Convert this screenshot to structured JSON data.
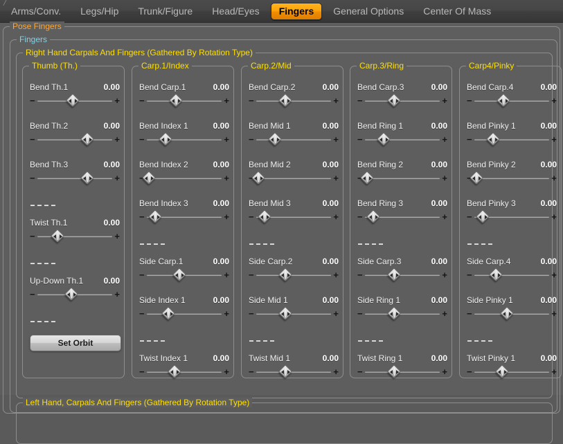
{
  "colors": {
    "accent_active_tab": "#f5a000",
    "panel_bg": "#5e5e5e",
    "legend_orange": "#ffa732",
    "legend_cyan": "#7fd4e8",
    "legend_yellow": "#ffe000",
    "label_text": "#efefef"
  },
  "tabs": [
    {
      "label": "Arms/Conv.",
      "active": false
    },
    {
      "label": "Legs/Hip",
      "active": false
    },
    {
      "label": "Trunk/Figure",
      "active": false
    },
    {
      "label": "Head/Eyes",
      "active": false
    },
    {
      "label": "Fingers",
      "active": true
    },
    {
      "label": "General Options",
      "active": false
    },
    {
      "label": "Center Of Mass",
      "active": false
    }
  ],
  "groups": {
    "pose_fingers": "Pose Fingers",
    "fingers": "Fingers",
    "right_hand": "Right Hand Carpals And Fingers (Gathered By Rotation Type)",
    "left_hand": "Left Hand, Carpals And Fingers (Gathered By Rotation Type)"
  },
  "slider_marks": {
    "minus": "−",
    "plus": "+"
  },
  "separator_text": "-------",
  "columns": [
    {
      "title": "Thumb (Th.)",
      "items": [
        {
          "kind": "slider",
          "label": "Bend Th.1",
          "value": "0.00",
          "pos": 48
        },
        {
          "kind": "slider",
          "label": "Bend Th.2",
          "value": "0.00",
          "pos": 68
        },
        {
          "kind": "slider",
          "label": "Bend Th.3",
          "value": "0.00",
          "pos": 68
        },
        {
          "kind": "sep"
        },
        {
          "kind": "slider",
          "label": "Twist Th.1",
          "value": "0.00",
          "pos": 28
        },
        {
          "kind": "sep"
        },
        {
          "kind": "slider",
          "label": "Up-Down Th.1",
          "value": "0.00",
          "pos": 46
        },
        {
          "kind": "sep"
        },
        {
          "kind": "button",
          "label": "Set Orbit"
        }
      ]
    },
    {
      "title": "Carp.1/Index",
      "items": [
        {
          "kind": "slider",
          "label": "Bend Carp.1",
          "value": "0.00",
          "pos": 40
        },
        {
          "kind": "slider",
          "label": "Bend Index 1",
          "value": "0.00",
          "pos": 26
        },
        {
          "kind": "slider",
          "label": "Bend Index 2",
          "value": "0.00",
          "pos": 4
        },
        {
          "kind": "slider",
          "label": "Bend Index 3",
          "value": "0.00",
          "pos": 12
        },
        {
          "kind": "sep"
        },
        {
          "kind": "slider",
          "label": "Side Carp.1",
          "value": "0.00",
          "pos": 44
        },
        {
          "kind": "slider",
          "label": "Side Index 1",
          "value": "0.00",
          "pos": 30
        },
        {
          "kind": "sep"
        },
        {
          "kind": "slider",
          "label": "Twist Index 1",
          "value": "0.00",
          "pos": 38
        }
      ]
    },
    {
      "title": "Carp.2/Mid",
      "items": [
        {
          "kind": "slider",
          "label": "Bend Carp.2",
          "value": "0.00",
          "pos": 40
        },
        {
          "kind": "slider",
          "label": "Bend Mid 1",
          "value": "0.00",
          "pos": 26
        },
        {
          "kind": "slider",
          "label": "Bend Mid 2",
          "value": "0.00",
          "pos": 4
        },
        {
          "kind": "slider",
          "label": "Bend Mid 3",
          "value": "0.00",
          "pos": 12
        },
        {
          "kind": "sep"
        },
        {
          "kind": "slider",
          "label": "Side Carp.2",
          "value": "0.00",
          "pos": 40
        },
        {
          "kind": "slider",
          "label": "Side Mid 1",
          "value": "0.00",
          "pos": 40
        },
        {
          "kind": "sep"
        },
        {
          "kind": "slider",
          "label": "Twist Mid 1",
          "value": "0.00",
          "pos": 40
        }
      ]
    },
    {
      "title": "Carp.3/Ring",
      "items": [
        {
          "kind": "slider",
          "label": "Bend Carp.3",
          "value": "0.00",
          "pos": 40
        },
        {
          "kind": "slider",
          "label": "Bend Ring 1",
          "value": "0.00",
          "pos": 26
        },
        {
          "kind": "slider",
          "label": "Bend Ring 2",
          "value": "0.00",
          "pos": 4
        },
        {
          "kind": "slider",
          "label": "Bend Ring 3",
          "value": "0.00",
          "pos": 12
        },
        {
          "kind": "sep"
        },
        {
          "kind": "slider",
          "label": "Side Carp.3",
          "value": "0.00",
          "pos": 40
        },
        {
          "kind": "slider",
          "label": "Side Ring 1",
          "value": "0.00",
          "pos": 40
        },
        {
          "kind": "sep"
        },
        {
          "kind": "slider",
          "label": "Twist Ring 1",
          "value": "0.00",
          "pos": 40
        }
      ]
    },
    {
      "title": "Carp4/Pinky",
      "items": [
        {
          "kind": "slider",
          "label": "Bend Carp.4",
          "value": "0.00",
          "pos": 40
        },
        {
          "kind": "slider",
          "label": "Bend Pinky 1",
          "value": "0.00",
          "pos": 26
        },
        {
          "kind": "slider",
          "label": "Bend Pinky 2",
          "value": "0.00",
          "pos": 4
        },
        {
          "kind": "slider",
          "label": "Bend Pinky 3",
          "value": "0.00",
          "pos": 12
        },
        {
          "kind": "sep"
        },
        {
          "kind": "slider",
          "label": "Side Carp.4",
          "value": "0.00",
          "pos": 30
        },
        {
          "kind": "slider",
          "label": "Side Pinky 1",
          "value": "0.00",
          "pos": 44
        },
        {
          "kind": "sep"
        },
        {
          "kind": "slider",
          "label": "Twist Pinky 1",
          "value": "0.00",
          "pos": 38
        }
      ]
    }
  ]
}
